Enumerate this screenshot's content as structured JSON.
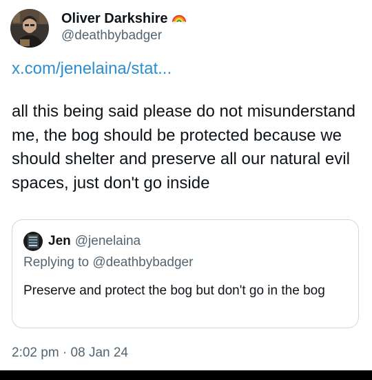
{
  "author": {
    "display_name": "Oliver Darkshire",
    "handle": "@deathbybadger",
    "badge_icon": "rainbow-icon"
  },
  "tweet": {
    "link_text": "x.com/jenelaina/stat...",
    "text": "all this being said please do not misunderstand me, the bog should be protected because we should shelter and preserve all our natural evil spaces, just don't go inside",
    "timestamp": "2:02 pm · 08 Jan 24"
  },
  "quoted_tweet": {
    "display_name": "Jen",
    "handle": "@jenelaina",
    "replying_prefix": "Replying to",
    "replying_to": "@deathbybadger",
    "text": "Preserve and protect the bog but don't go in the bog"
  },
  "colors": {
    "link": "#2b8ecf",
    "secondary_text": "#536471",
    "border": "#cfd9de"
  }
}
